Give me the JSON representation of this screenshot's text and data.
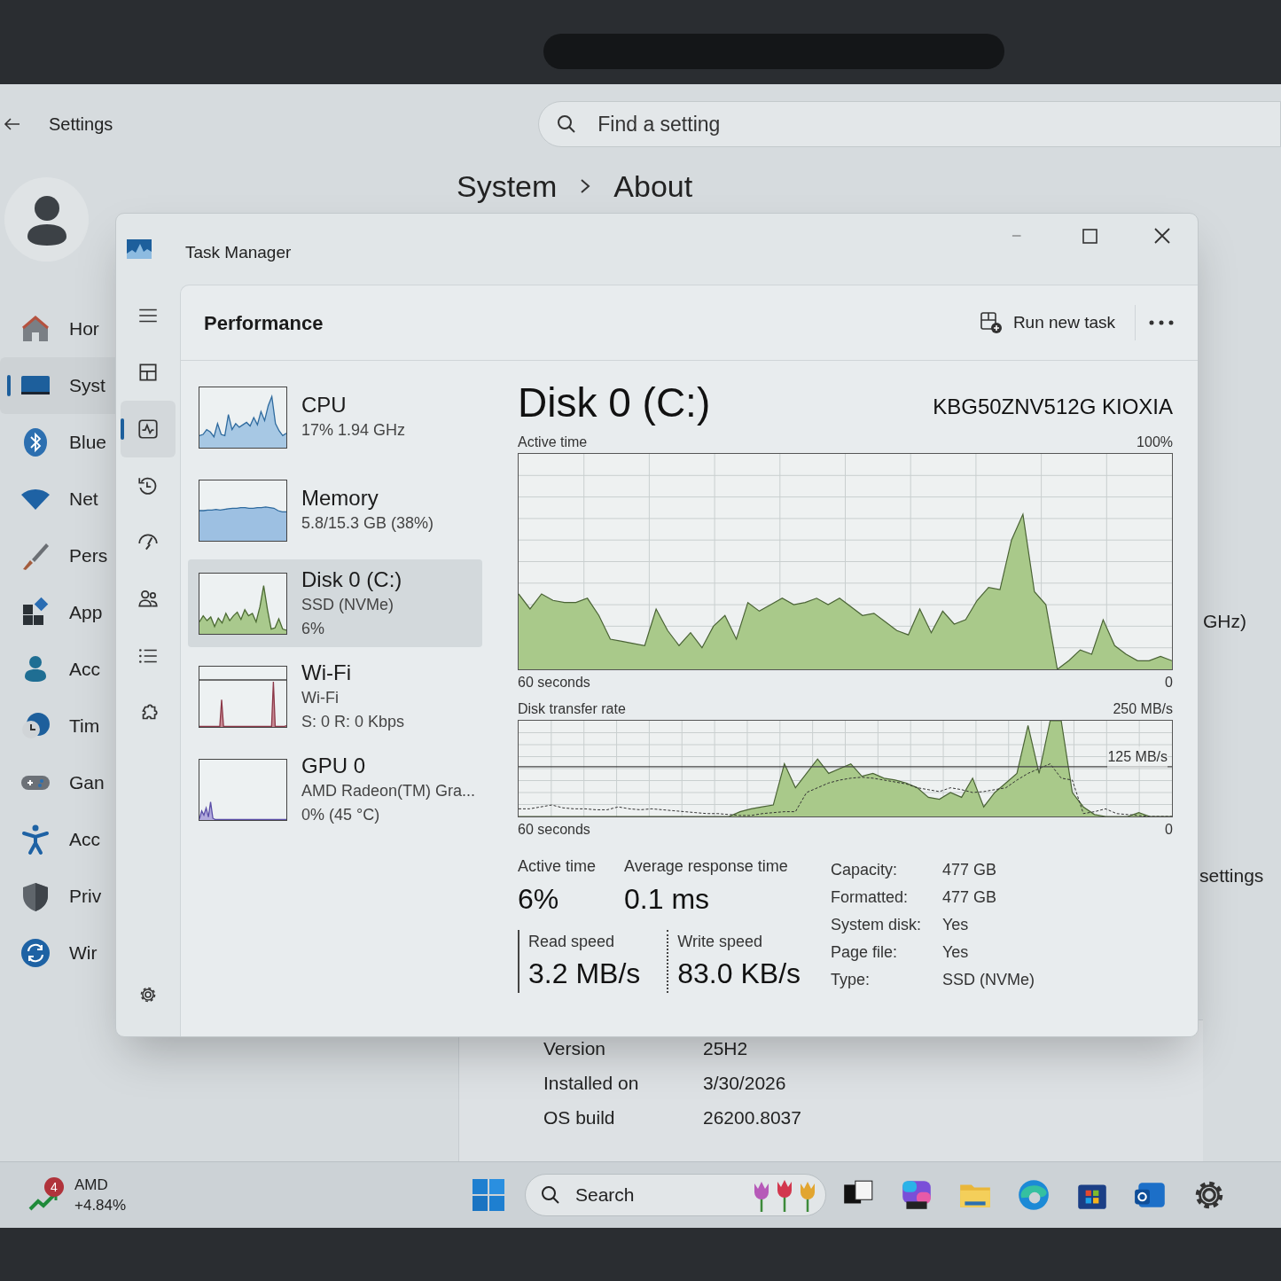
{
  "settings": {
    "title": "Settings",
    "search": {
      "placeholder": "Find a setting"
    },
    "breadcrumb": [
      "System",
      "About"
    ],
    "nav": [
      {
        "label": "Hor",
        "kind": "home",
        "selected": false
      },
      {
        "label": "Syst",
        "kind": "system",
        "selected": true
      },
      {
        "label": "Blue",
        "kind": "bluetooth",
        "selected": false
      },
      {
        "label": "Net",
        "kind": "network",
        "selected": false
      },
      {
        "label": "Pers",
        "kind": "brush",
        "selected": false
      },
      {
        "label": "App",
        "kind": "apps",
        "selected": false
      },
      {
        "label": "Acc",
        "kind": "account",
        "selected": false
      },
      {
        "label": "Tim",
        "kind": "time",
        "selected": false
      },
      {
        "label": "Gan",
        "kind": "gaming",
        "selected": false
      },
      {
        "label": "Acc",
        "kind": "accessibility",
        "selected": false
      },
      {
        "label": "Priv",
        "kind": "privacy",
        "selected": false
      },
      {
        "label": "Wir",
        "kind": "update",
        "selected": false
      }
    ],
    "edge_texts": [
      "GHz)",
      "settings"
    ],
    "info_rows": [
      {
        "label": "Version",
        "value": "25H2"
      },
      {
        "label": "Installed on",
        "value": "3/30/2026"
      },
      {
        "label": "OS build",
        "value": "26200.8037"
      }
    ]
  },
  "task_manager": {
    "title": "Task Manager",
    "nav": [
      {
        "kind": "menu",
        "selected": false
      },
      {
        "kind": "processes",
        "selected": false
      },
      {
        "kind": "performance",
        "selected": true
      },
      {
        "kind": "history",
        "selected": false
      },
      {
        "kind": "startup",
        "selected": false
      },
      {
        "kind": "users",
        "selected": false
      },
      {
        "kind": "details",
        "selected": false
      },
      {
        "kind": "services",
        "selected": false
      }
    ],
    "page_title": "Performance",
    "run_new_task": "Run new task",
    "devices": [
      {
        "kind": "cpu",
        "name": "CPU",
        "lines": [
          "17% 1.94 GHz"
        ],
        "selected": false
      },
      {
        "kind": "memory",
        "name": "Memory",
        "lines": [
          "5.8/15.3 GB (38%)"
        ],
        "selected": false
      },
      {
        "kind": "disk",
        "name": "Disk 0 (C:)",
        "lines": [
          "SSD (NVMe)",
          "6%"
        ],
        "selected": true
      },
      {
        "kind": "wifi",
        "name": "Wi-Fi",
        "lines": [
          "Wi-Fi",
          "S: 0 R: 0 Kbps"
        ],
        "selected": false
      },
      {
        "kind": "gpu",
        "name": "GPU 0",
        "lines": [
          "AMD Radeon(TM) Gra...",
          "0% (45 °C)"
        ],
        "selected": false
      }
    ],
    "detail": {
      "title": "Disk 0 (C:)",
      "model": "KBG50ZNV512G KIOXIA",
      "active_chart": {
        "label": "Active time",
        "max": "100%",
        "span": "60 seconds",
        "min": "0"
      },
      "transfer_chart": {
        "label": "Disk transfer rate",
        "max": "250 MB/s",
        "mid": "125 MB/s",
        "span": "60 seconds",
        "min": "0"
      },
      "stats": [
        {
          "label": "Active time",
          "value": "6%"
        },
        {
          "label": "Average response time",
          "value": "0.1 ms"
        }
      ],
      "speeds": [
        {
          "kind": "read",
          "label": "Read speed",
          "value": "3.2 MB/s"
        },
        {
          "kind": "write",
          "label": "Write speed",
          "value": "83.0 KB/s"
        }
      ],
      "properties": [
        {
          "label": "Capacity:",
          "value": "477 GB"
        },
        {
          "label": "Formatted:",
          "value": "477 GB"
        },
        {
          "label": "System disk:",
          "value": "Yes"
        },
        {
          "label": "Page file:",
          "value": "Yes"
        },
        {
          "label": "Type:",
          "value": "SSD (NVMe)"
        }
      ]
    }
  },
  "taskbar": {
    "widget": {
      "badge": "4",
      "title": "AMD",
      "change": "+4.84%"
    },
    "search_label": "Search"
  }
}
